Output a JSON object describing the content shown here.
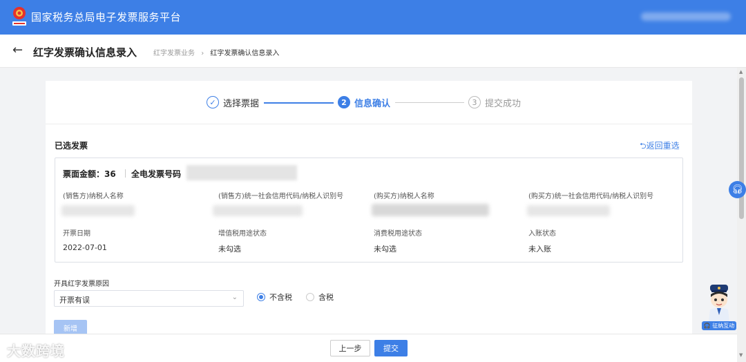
{
  "app": {
    "title": "国家税务总局电子发票服务平台"
  },
  "header": {
    "page_title": "红字发票确认信息录入",
    "breadcrumb": [
      {
        "label": "红字发票业务"
      },
      {
        "label": "红字发票确认信息录入"
      }
    ]
  },
  "steps": [
    {
      "index": "✓",
      "label": "选择票据",
      "status": "done"
    },
    {
      "index": "2",
      "label": "信息确认",
      "status": "active"
    },
    {
      "index": "3",
      "label": "提交成功",
      "status": "pending"
    }
  ],
  "selected": {
    "section_title": "已选发票",
    "reselect_label": "⮌返回重选",
    "amount_label": "票面金额：36",
    "invoice_no_label": "全电发票号码",
    "fields": {
      "seller_name": {
        "label": "(销售方)纳税人名称"
      },
      "seller_id": {
        "label": "(销售方)统一社会信用代码/纳税人识别号"
      },
      "buyer_name": {
        "label": "(购买方)纳税人名称"
      },
      "buyer_id": {
        "label": "(购买方)统一社会信用代码/纳税人识别号"
      },
      "date": {
        "label": "开票日期",
        "value": "2022-07-01"
      },
      "vat_use": {
        "label": "增值税用途状态",
        "value": "未勾选"
      },
      "consumption_use": {
        "label": "消费税用途状态",
        "value": "未勾选"
      },
      "entry": {
        "label": "入账状态",
        "value": "未入账"
      }
    }
  },
  "form": {
    "reason_label": "开具红字发票原因",
    "reason_value": "开票有误",
    "tax_options": [
      {
        "label": "不含税",
        "selected": true
      },
      {
        "label": "含税",
        "selected": false
      }
    ],
    "add_label": "新增"
  },
  "footer": {
    "prev_label": "上一步",
    "submit_label": "提交",
    "watermark": "大数跨境"
  },
  "widgets": {
    "support_icon": "headset-icon",
    "assistant_label": "🎧 征纳互动"
  },
  "colors": {
    "primary": "#3d7fe6",
    "disabled": "#a6c4f4"
  }
}
